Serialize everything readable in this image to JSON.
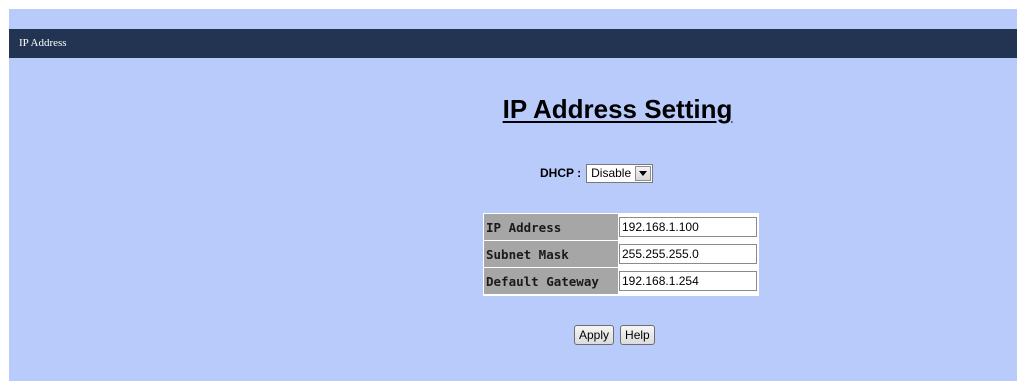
{
  "titlebar": {
    "title": "IP Address"
  },
  "page": {
    "heading": "IP Address Setting"
  },
  "dhcp": {
    "label": "DHCP :",
    "selected": "Disable",
    "icon": "chevron-down-icon"
  },
  "fields": [
    {
      "label": "IP Address",
      "value": "192.168.1.100"
    },
    {
      "label": "Subnet Mask",
      "value": "255.255.255.0"
    },
    {
      "label": "Default Gateway",
      "value": "192.168.1.254"
    }
  ],
  "buttons": {
    "apply": "Apply",
    "help": "Help"
  },
  "colors": {
    "background": "#b9cbfb",
    "titlebar": "#233352",
    "label_cell": "#a6a6a6"
  }
}
